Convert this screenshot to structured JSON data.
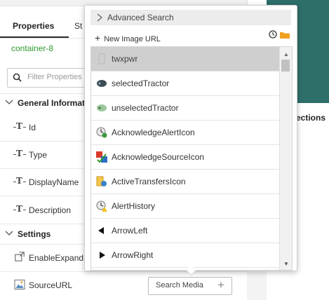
{
  "properties_panel": {
    "tabs": [
      "Properties",
      "St"
    ],
    "container_name": "container-8",
    "filter_placeholder": "Filter Properties",
    "sections": [
      {
        "label": "General Informati",
        "props": [
          "Id",
          "Type",
          "DisplayName",
          "Description"
        ]
      },
      {
        "label": "Settings",
        "props": [
          "EnableExpand",
          "SourceURL"
        ]
      }
    ],
    "search_media_label": "Search Media",
    "search_media_plus": "+"
  },
  "background": {
    "connections_label": "ections",
    "teal_color": "#2e6f6a"
  },
  "image_picker": {
    "advanced_search_label": "Advanced Search",
    "new_image_url_label": "New Image URL",
    "new_image_url_plus": "+",
    "history_icon": "clock-icon",
    "folder_icon": "folder-icon",
    "items": [
      {
        "label": "twxpwr",
        "icon": "placeholder-image-icon",
        "selected": true
      },
      {
        "label": "selectedTractor",
        "icon": "tractor-dark-icon",
        "selected": false
      },
      {
        "label": "unselectedTractor",
        "icon": "tractor-green-icon",
        "selected": false
      },
      {
        "label": "AcknowledgeAlertIcon",
        "icon": "acknowledge-alert-icon",
        "selected": false
      },
      {
        "label": "AcknowledgeSourceIcon",
        "icon": "acknowledge-source-icon",
        "selected": false
      },
      {
        "label": "ActiveTransfersIcon",
        "icon": "active-transfers-icon",
        "selected": false
      },
      {
        "label": "AlertHistory",
        "icon": "alert-history-icon",
        "selected": false
      },
      {
        "label": "ArrowLeft",
        "icon": "arrow-left-icon",
        "selected": false
      },
      {
        "label": "ArrowRight",
        "icon": "arrow-right-icon",
        "selected": false
      }
    ]
  }
}
